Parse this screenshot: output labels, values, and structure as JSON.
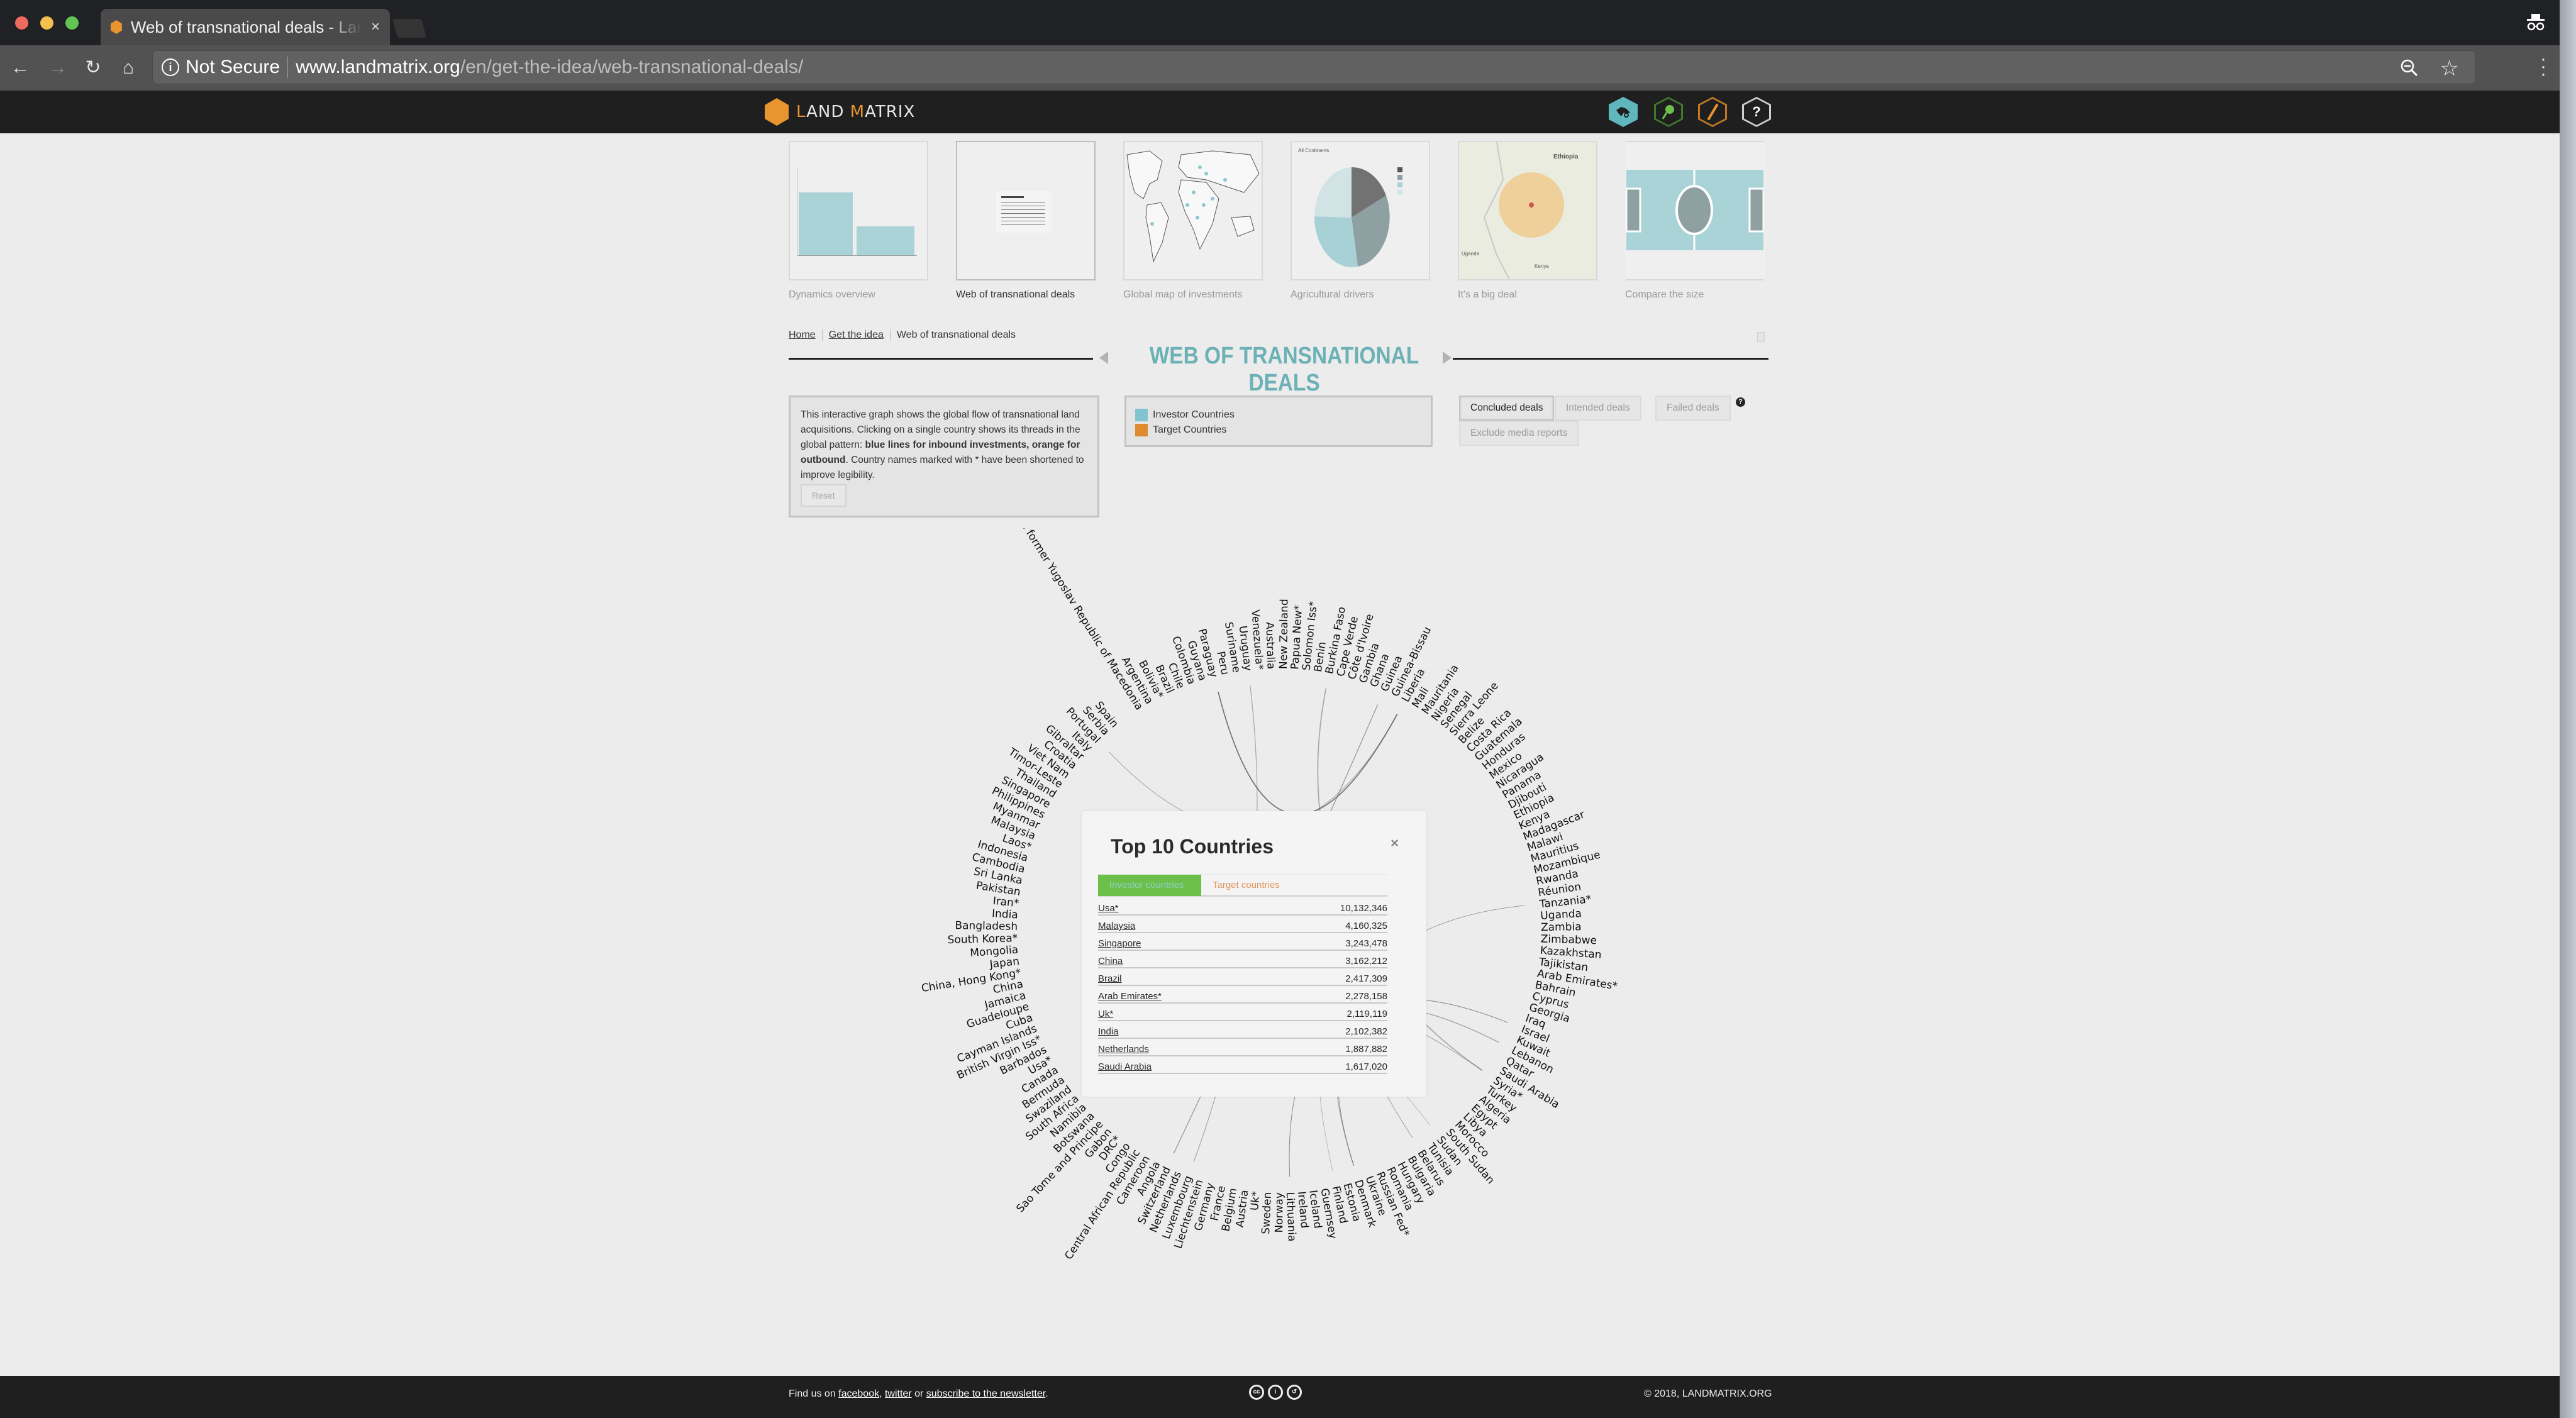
{
  "browser": {
    "tab_title": "Web of transnational deals - Land Matrix",
    "tab_close": "×",
    "security_label": "Not Secure",
    "url_host": "www.landmatrix.org",
    "url_path": "/en/get-the-idea/web-transnational-deals/",
    "icons": {
      "back": "back-arrow-icon",
      "forward": "forward-arrow-icon",
      "reload": "reload-icon",
      "home": "home-icon",
      "info": "info-icon",
      "zoom": "zoom-out-icon",
      "bookmark": "star-icon",
      "menu": "kebab-menu-icon",
      "profile": "incognito-icon"
    }
  },
  "header": {
    "logo_first": "L",
    "logo_and": "AND ",
    "logo_m": "M",
    "logo_rest": "ATRIX",
    "icons": [
      "globe-icon",
      "search-icon",
      "pencil-icon",
      "help-icon"
    ],
    "help_glyph": "?"
  },
  "thumbnails": [
    {
      "label": "Dynamics overview",
      "active": false
    },
    {
      "label": "Web of transnational deals",
      "active": true
    },
    {
      "label": "Global map of investments",
      "active": false
    },
    {
      "label": "Agricultural drivers",
      "active": false
    },
    {
      "label": "It's a big deal",
      "active": false
    },
    {
      "label": "Compare the size",
      "active": false
    }
  ],
  "thumb_text": {
    "pie_title": "All Continents",
    "map_ethiopia": "Ethiopia",
    "map_uganda": "Uganda",
    "map_kenya": "Kenya"
  },
  "breadcrumb": [
    "Home",
    "Get the idea",
    "Web of transnational deals"
  ],
  "page_title": "WEB OF TRANSNATIONAL DEALS",
  "description": {
    "text_1": "This interactive graph shows the global flow of transnational land acquisitions. Clicking on a single country shows its threads in the global pattern: ",
    "bold": "blue lines for inbound investments, orange for outbound",
    "text_2": ". Country names marked with * have been shortened to improve legibility.",
    "reset_label": "Reset"
  },
  "legend": {
    "items": [
      {
        "label": "Investor Countries",
        "color": "#7fc4cf"
      },
      {
        "label": "Target Countries",
        "color": "#e08a2e"
      }
    ]
  },
  "filters": {
    "concluded": "Concluded deals",
    "intended": "Intended deals",
    "failed": "Failed deals",
    "exclude_media": "Exclude media reports",
    "active": "concluded",
    "help_glyph": "?"
  },
  "web_graph": {
    "countries": [
      "The former Yugoslav Republic of Macedonia",
      "Argentina",
      "Bolivia*",
      "Brazil",
      "Chile",
      "Colombia",
      "Guyana",
      "Paraguay",
      "Peru",
      "Suriname",
      "Uruguay",
      "Venezuela*",
      "Australia",
      "New Zealand",
      "Papua New*",
      "Solomon Iss*",
      "Benin",
      "Burkina Faso",
      "Cape Verde",
      "Côte d'Ivoire",
      "Gambia",
      "Ghana",
      "Guinea",
      "Guinea-Bissau",
      "Liberia",
      "Mali",
      "Mauritania",
      "Nigeria",
      "Senegal",
      "Sierra Leone",
      "Belize",
      "Costa Rica",
      "Guatemala",
      "Honduras",
      "Mexico",
      "Nicaragua",
      "Panama",
      "Djibouti",
      "Ethiopia",
      "Kenya",
      "Madagascar",
      "Malawi",
      "Mauritius",
      "Mozambique",
      "Rwanda",
      "Réunion",
      "Tanzania*",
      "Uganda",
      "Zambia",
      "Zimbabwe",
      "Kazakhstan",
      "Tajikistan",
      "Arab Emirates*",
      "Bahrain",
      "Cyprus",
      "Georgia",
      "Iraq",
      "Israel",
      "Kuwait",
      "Lebanon",
      "Qatar",
      "Saudi Arabia",
      "Syria*",
      "Turkey",
      "Algeria",
      "Egypt",
      "Libya",
      "Morocco",
      "South Sudan",
      "Sudan",
      "Tunisia",
      "Belarus",
      "Bulgaria",
      "Hungary",
      "Romania",
      "Russian Fed*",
      "Ukraine",
      "Denmark",
      "Estonia",
      "Finland",
      "Guernsey",
      "Iceland",
      "Ireland",
      "Lithuania",
      "Norway",
      "Sweden",
      "Uk*",
      "Austria",
      "Belgium",
      "France",
      "Germany",
      "Liechtenstein",
      "Luxembourg",
      "Netherlands",
      "Switzerland",
      "Angola",
      "Cameroon",
      "Central African Republic",
      "Congo",
      "DRC*",
      "Gabon",
      "Sao Tome and Principe",
      "Botswana",
      "Namibia",
      "South Africa",
      "Swaziland",
      "Bermuda",
      "Canada",
      "Usa*",
      "Barbados",
      "British Virgin Iss*",
      "Cayman Islands",
      "Cuba",
      "Guadeloupe",
      "Jamaica",
      "China",
      "China, Hong Kong*",
      "Japan",
      "Mongolia",
      "South Korea*",
      "Bangladesh",
      "India",
      "Iran*",
      "Pakistan",
      "Sri Lanka",
      "Cambodia",
      "Indonesia",
      "Laos*",
      "Malaysia",
      "Myanmar",
      "Philippines",
      "Singapore",
      "Thailand",
      "Timor-Leste",
      "Viet Nam",
      "Croatia",
      "Gibraltar",
      "Italy",
      "Portugal",
      "Serbia",
      "Spain"
    ],
    "link_color": "#555555"
  },
  "top10": {
    "title": "Top 10 Countries",
    "close": "×",
    "tabs": {
      "investor": "Investor countries",
      "target": "Target countries",
      "active": "investor"
    },
    "rows": [
      {
        "country": "Usa*",
        "value": "10,132,346"
      },
      {
        "country": "Malaysia",
        "value": "4,160,325"
      },
      {
        "country": "Singapore",
        "value": "3,243,478"
      },
      {
        "country": "China",
        "value": "3,162,212"
      },
      {
        "country": "Brazil",
        "value": "2,417,309"
      },
      {
        "country": "Arab Emirates*",
        "value": "2,278,158"
      },
      {
        "country": "Uk*",
        "value": "2,119,119"
      },
      {
        "country": "India",
        "value": "2,102,382"
      },
      {
        "country": "Netherlands",
        "value": "1,887,882"
      },
      {
        "country": "Saudi Arabia",
        "value": "1,617,020"
      }
    ]
  },
  "footer": {
    "find_us": "Find us on ",
    "facebook": "facebook",
    "comma": ", ",
    "twitter": "twitter",
    "or": " or ",
    "newsletter": "subscribe to the newsletter",
    "period": ".",
    "cc_icons": [
      "cc-icon",
      "by-icon",
      "sa-icon"
    ],
    "cc_glyphs": [
      "cc",
      "i",
      "↺"
    ],
    "copyright": "© 2018, LANDMATRIX.ORG"
  }
}
